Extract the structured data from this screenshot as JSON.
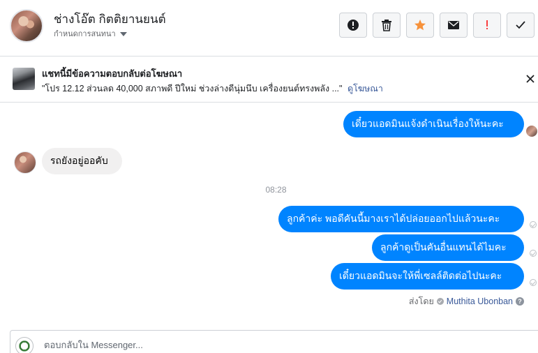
{
  "header": {
    "contact_name": "ช่างโอ๊ต กิตติยานยนต์",
    "assign_label": "กำหนดการสนทนา",
    "actions": [
      {
        "icon": "alert-circle-icon",
        "color": "#1c1e21"
      },
      {
        "icon": "trash-icon",
        "color": "#1c1e21"
      },
      {
        "icon": "star-icon",
        "color": "#f7923b"
      },
      {
        "icon": "envelope-icon",
        "color": "#1c1e21"
      },
      {
        "icon": "exclamation-icon",
        "color": "#fa3e3e"
      },
      {
        "icon": "checkmark-icon",
        "color": "#1c1e21"
      }
    ]
  },
  "ad_banner": {
    "title": "แชทนี้มีข้อความตอบกลับต่อโฆษณา",
    "quote": "\"โปร 12.12 ส่วนลด 40,000 สภาพดี ปีใหม่ ช่วงล่างดีนุ่มนึบ เครื่องยนต์ทรงพลัง ...\"",
    "link_label": "ดูโฆษณา"
  },
  "messages": {
    "m1": "เดี๋ยวแอดมินแจ้งดำเนินเรื่องให้นะคะ",
    "m2": "รถยังอยู่ออคับ",
    "timestamp": "08:28",
    "m3": "ลูกค้าค่ะ พอดีคันนี้มางเราได้ปล่อยออกไปแล้วนะคะ",
    "m4": "ลูกค้าดูเป็นคันอื่นแทนได้ไมคะ",
    "m5": "เดี๋ยวแอดมินจะให้พี่เซลล์ติดต่อไปนะคะ"
  },
  "sent_by": {
    "prefix": "ส่งโดย",
    "sender": "Muthita Ubonban",
    "help": "?"
  },
  "composer": {
    "placeholder": "ตอบกลับใน Messenger..."
  },
  "colors": {
    "outgoing_bubble": "#0084ff",
    "incoming_bubble": "#f1f0f0",
    "link": "#385898"
  }
}
